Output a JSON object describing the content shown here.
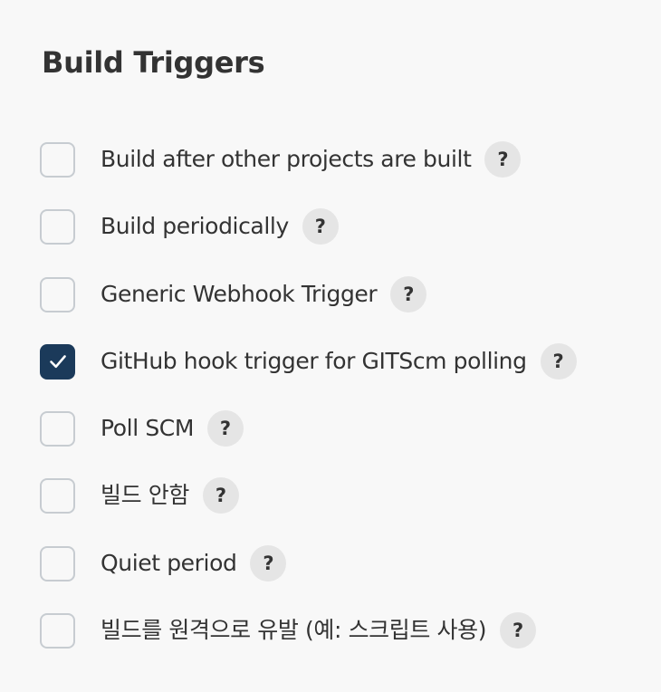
{
  "section": {
    "title": "Build Triggers"
  },
  "options": [
    {
      "label": "Build after other projects are built",
      "checked": false,
      "help": "?"
    },
    {
      "label": "Build periodically",
      "checked": false,
      "help": "?"
    },
    {
      "label": "Generic Webhook Trigger",
      "checked": false,
      "help": "?"
    },
    {
      "label": "GitHub hook trigger for GITScm polling",
      "checked": true,
      "help": "?"
    },
    {
      "label": "Poll SCM",
      "checked": false,
      "help": "?"
    },
    {
      "label": "빌드 안함",
      "checked": false,
      "help": "?"
    },
    {
      "label": "Quiet period",
      "checked": false,
      "help": "?"
    },
    {
      "label": "빌드를 원격으로 유발 (예: 스크립트 사용)",
      "checked": false,
      "help": "?"
    }
  ],
  "colors": {
    "checked_fill": "#1b3a5a",
    "unchecked_border": "#c7ccd1",
    "help_bg": "#e5e5e5",
    "text": "#333333",
    "background": "#f8f8f8"
  },
  "icons": {
    "check": "check-icon"
  }
}
